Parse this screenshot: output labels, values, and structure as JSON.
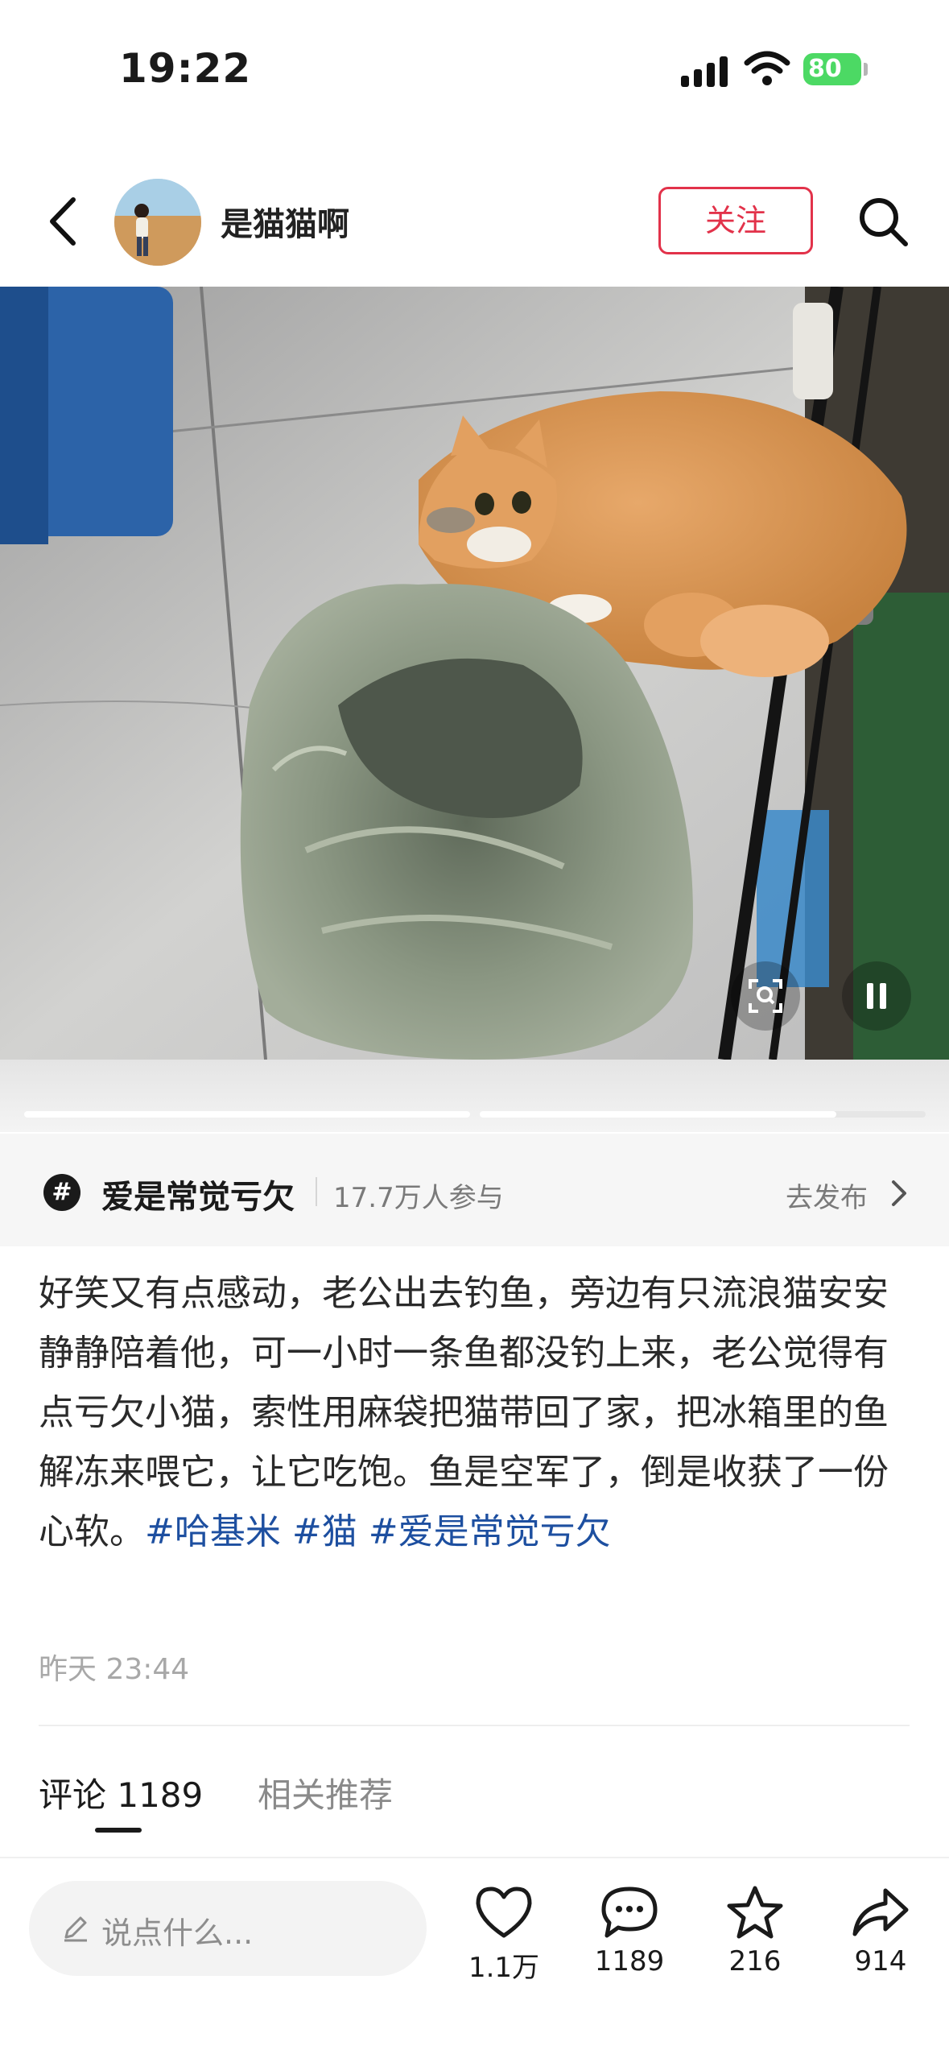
{
  "status_bar": {
    "time": "19:22",
    "battery": "80"
  },
  "header": {
    "author_name": "是猫猫啊",
    "follow_label": "关注"
  },
  "media": {
    "progress": [
      1.0,
      0.8
    ]
  },
  "topic": {
    "name": "爱是常觉亏欠",
    "participants": "17.7万人参与",
    "action": "去发布"
  },
  "post": {
    "text": "好笑又有点感动，老公出去钓鱼，旁边有只流浪猫安安静静陪着他，可一小时一条鱼都没钓上来，老公觉得有点亏欠小猫，索性用麻袋把猫带回了家，把冰箱里的鱼解冻来喂它，让它吃饱。鱼是空军了，倒是收获了一份心软。",
    "tags": [
      "#哈基米",
      "#猫",
      "#爱是常觉亏欠"
    ],
    "time": "昨天 23:44"
  },
  "tabs": {
    "comments": "评论 1189",
    "related": "相关推荐"
  },
  "bottom_bar": {
    "input_placeholder": "说点什么...",
    "likes": "1.1万",
    "comments": "1189",
    "stars": "216",
    "shares": "914"
  },
  "colors": {
    "accent": "#e2324a",
    "tag": "#1d4fa0",
    "battery": "#4cd964"
  }
}
